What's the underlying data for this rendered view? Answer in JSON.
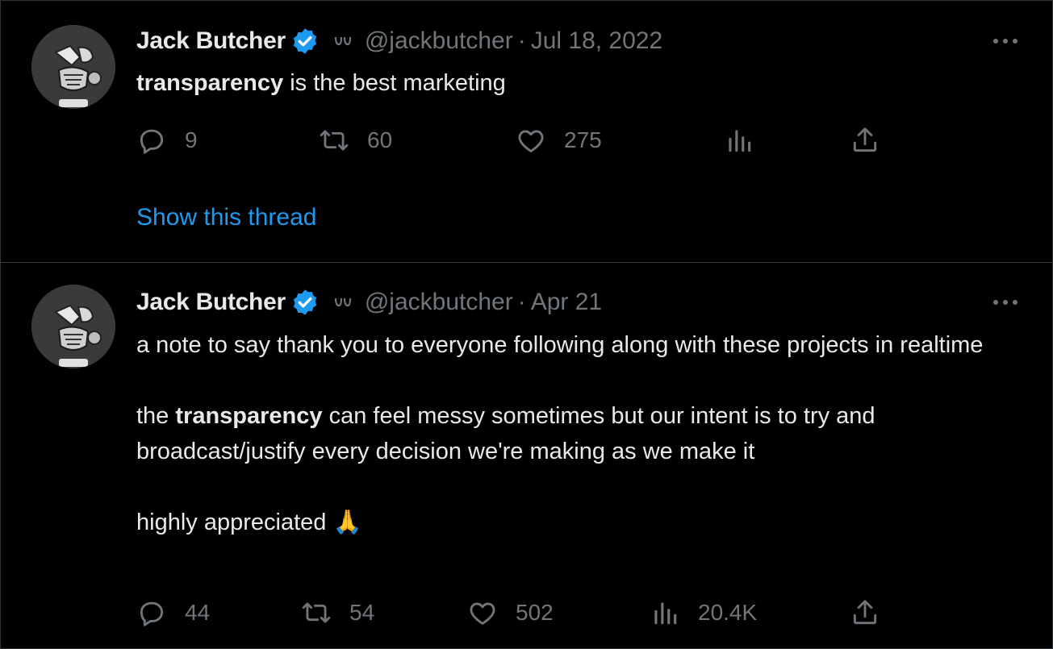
{
  "tweets": [
    {
      "author": {
        "name": "Jack Butcher",
        "handle": "@jackbutcher"
      },
      "date": "Jul 18, 2022",
      "text": {
        "bold": "transparency",
        "rest": " is the best marketing"
      },
      "stats": {
        "replies": "9",
        "retweets": "60",
        "likes": "275",
        "views": ""
      },
      "show_thread": "Show this thread"
    },
    {
      "author": {
        "name": "Jack Butcher",
        "handle": "@jackbutcher"
      },
      "date": "Apr 21",
      "text": {
        "p1": "a note to say thank you to everyone following along with these projects in realtime",
        "p2_before": "the ",
        "p2_bold": "transparency",
        "p2_after": " can feel messy sometimes but our intent is to try and broadcast/justify every decision we're making as we make it",
        "p3": "highly appreciated 🙏"
      },
      "stats": {
        "replies": "44",
        "retweets": "54",
        "likes": "502",
        "views": "20.4K"
      }
    }
  ],
  "separator": "·",
  "colors": {
    "background": "#000000",
    "text": "#e7e9ea",
    "muted": "#71767b",
    "accent": "#1d9bf0",
    "divider": "#2f3336"
  },
  "icons": [
    "verified-badge-icon",
    "affiliate-badge-icon",
    "more-icon",
    "reply-icon",
    "retweet-icon",
    "like-icon",
    "views-icon",
    "share-icon"
  ]
}
